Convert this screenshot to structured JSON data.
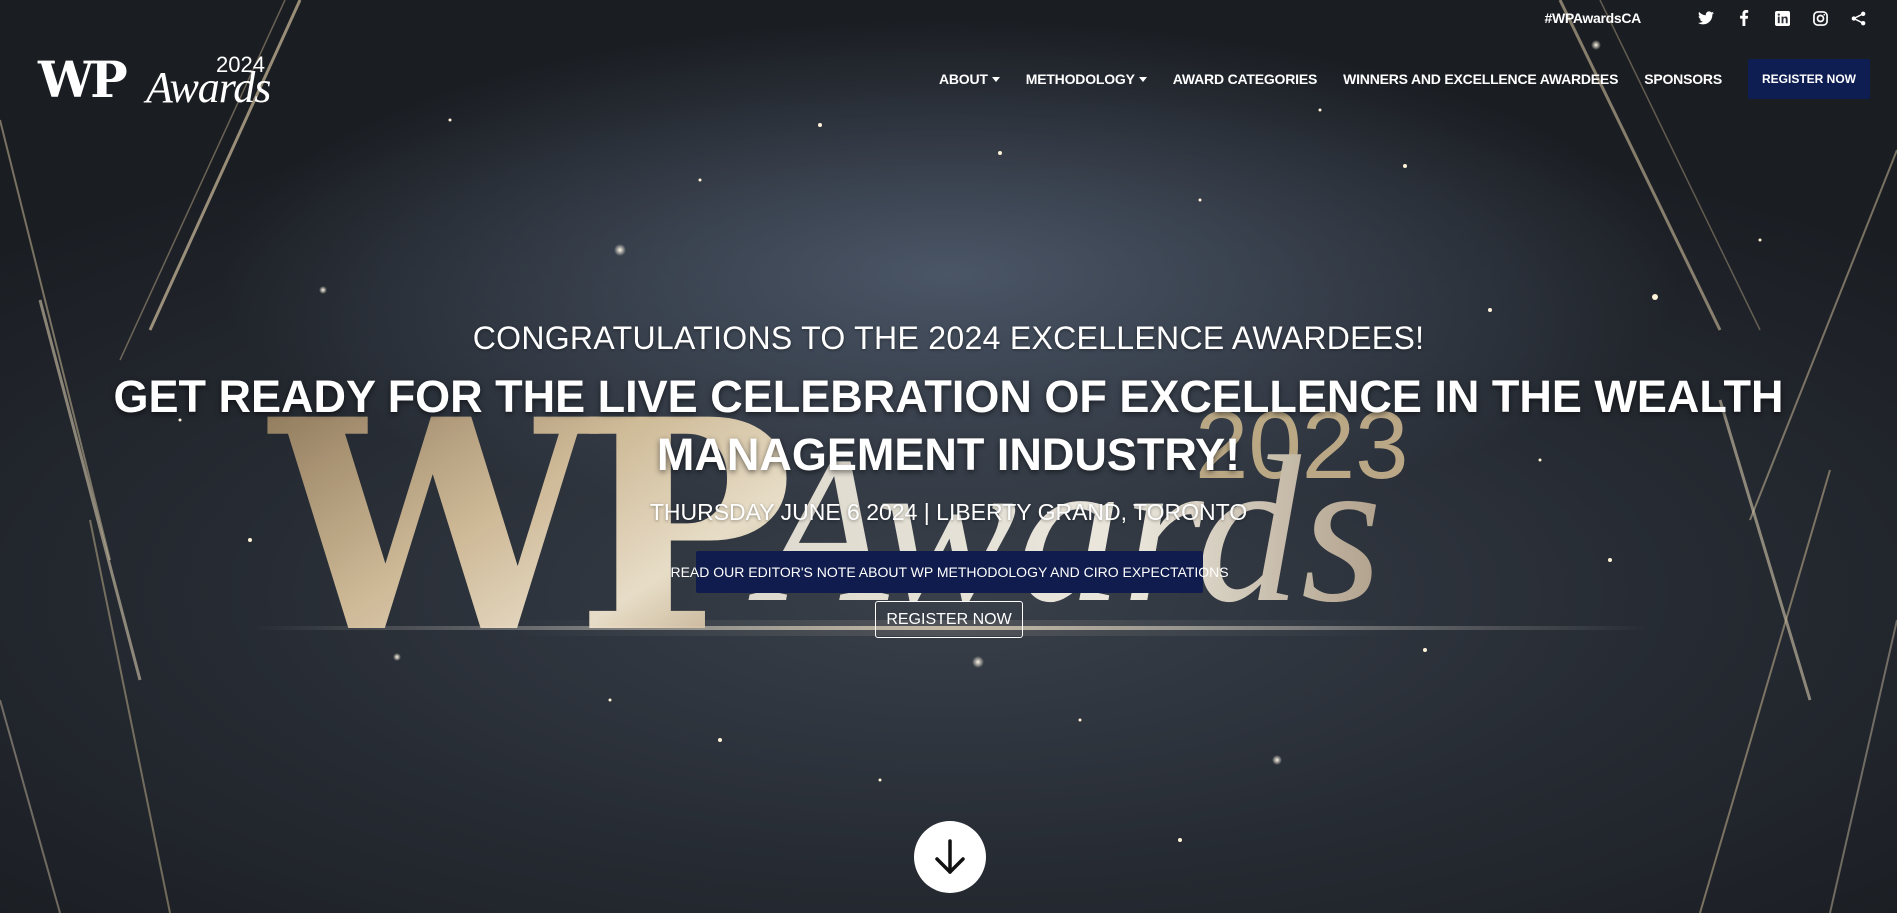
{
  "brand": {
    "logo_wp": "WP",
    "logo_awards": "Awards",
    "logo_year": "2024"
  },
  "topbar": {
    "hashtag": "#WPAwardsCA",
    "icons": [
      "twitter-icon",
      "facebook-icon",
      "linkedin-icon",
      "instagram-icon",
      "share-icon"
    ]
  },
  "nav": {
    "items": [
      {
        "label": "ABOUT",
        "dropdown": true
      },
      {
        "label": "METHODOLOGY",
        "dropdown": true
      },
      {
        "label": "AWARD CATEGORIES",
        "dropdown": false
      },
      {
        "label": "WINNERS AND EXCELLENCE AWARDEES",
        "dropdown": false
      },
      {
        "label": "SPONSORS",
        "dropdown": false
      }
    ],
    "register_label": "REGISTER NOW"
  },
  "hero": {
    "congrats": "CONGRATULATIONS TO THE 2024 EXCELLENCE AWARDEES!",
    "headline": "GET READY FOR THE LIVE CELEBRATION OF EXCELLENCE IN THE WEALTH MANAGEMENT INDUSTRY!",
    "event_date": "THURSDAY JUNE 6 2024 | LIBERTY GRAND, TORONTO",
    "editor_note_label": "READ OUR EDITOR'S NOTE ABOUT WP METHODOLOGY AND CIRO EXPECTATIONS",
    "register_label": "REGISTER NOW",
    "background_art": {
      "wp": "WP",
      "year": "2023",
      "awards": "Awards"
    }
  },
  "colors": {
    "nav_button_bg": "#0f1e52",
    "editor_note_bg": "#101c4d",
    "gold": "#c9ad82",
    "background_dark": "#262b33"
  }
}
